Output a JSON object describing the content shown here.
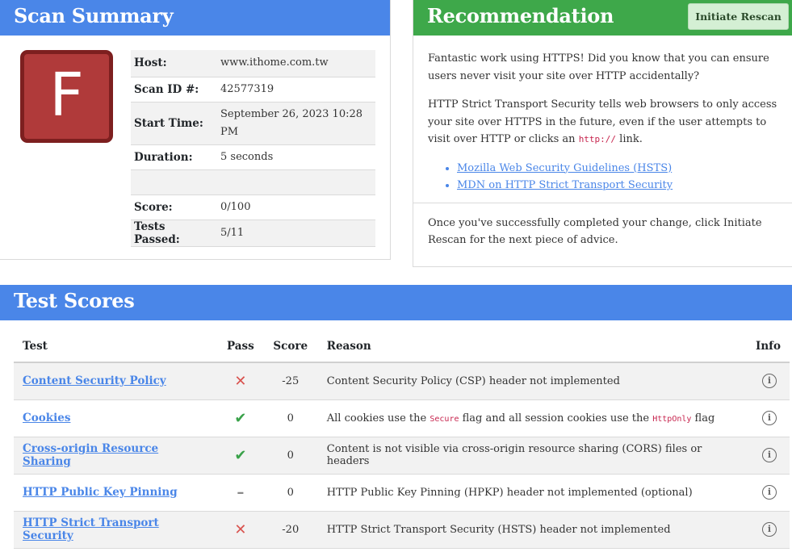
{
  "summary": {
    "title": "Scan Summary",
    "grade": "F",
    "rows": [
      {
        "key": "Host:",
        "value": "www.ithome.com.tw"
      },
      {
        "key": "Scan ID #:",
        "value": "42577319"
      },
      {
        "key": "Start Time:",
        "value": "September 26, 2023 10:28 PM"
      },
      {
        "key": "Duration:",
        "value": "5 seconds"
      },
      {
        "key": "",
        "value": ""
      },
      {
        "key": "Score:",
        "value": "0/100"
      },
      {
        "key": "Tests Passed:",
        "value": "5/11"
      }
    ]
  },
  "recommendation": {
    "title": "Recommendation",
    "rescan_label": "Initiate Rescan",
    "para1": "Fantastic work using HTTPS! Did you know that you can ensure users never visit your site over HTTP accidentally?",
    "para2_pre": "HTTP Strict Transport Security tells web browsers to only access your site over HTTPS in the future, even if the user attempts to visit over HTTP or clicks an ",
    "para2_code": "http://",
    "para2_post": " link.",
    "links": [
      "Mozilla Web Security Guidelines (HSTS)",
      "MDN on HTTP Strict Transport Security"
    ],
    "para3": "Once you've successfully completed your change, click Initiate Rescan for the next piece of advice."
  },
  "scores": {
    "title": "Test Scores",
    "headers": {
      "test": "Test",
      "pass": "Pass",
      "score": "Score",
      "reason": "Reason",
      "info": "Info"
    },
    "rows": [
      {
        "test": "Content Security Policy",
        "pass": "✕",
        "score": "-25",
        "reason": "Content Security Policy (CSP) header not implemented",
        "info_icon": "info-icon"
      },
      {
        "test": "Cookies",
        "pass": "✔",
        "score": "0",
        "reason_pre": "All cookies use the ",
        "reason_code1": "Secure",
        "reason_mid": " flag and all session cookies use the ",
        "reason_code2": "HttpOnly",
        "reason_post": " flag",
        "info_icon": "info-icon"
      },
      {
        "test": "Cross-origin Resource Sharing",
        "pass": "✔",
        "score": "0",
        "reason": "Content is not visible via cross-origin resource sharing (CORS) files or headers",
        "info_icon": "info-icon"
      },
      {
        "test": "HTTP Public Key Pinning",
        "pass": "–",
        "score": "0",
        "reason": "HTTP Public Key Pinning (HPKP) header not implemented (optional)",
        "info_icon": "info-icon"
      },
      {
        "test": "HTTP Strict Transport Security",
        "pass": "✕",
        "score": "-20",
        "reason": "HTTP Strict Transport Security (HSTS) header not implemented",
        "info_icon": "info-icon"
      }
    ]
  },
  "colors": {
    "header_blue": "#4a86e8",
    "header_green": "#3ea84a",
    "grade_red": "#b03a3a",
    "fail": "#d9534f",
    "pass": "#3aa24a"
  }
}
